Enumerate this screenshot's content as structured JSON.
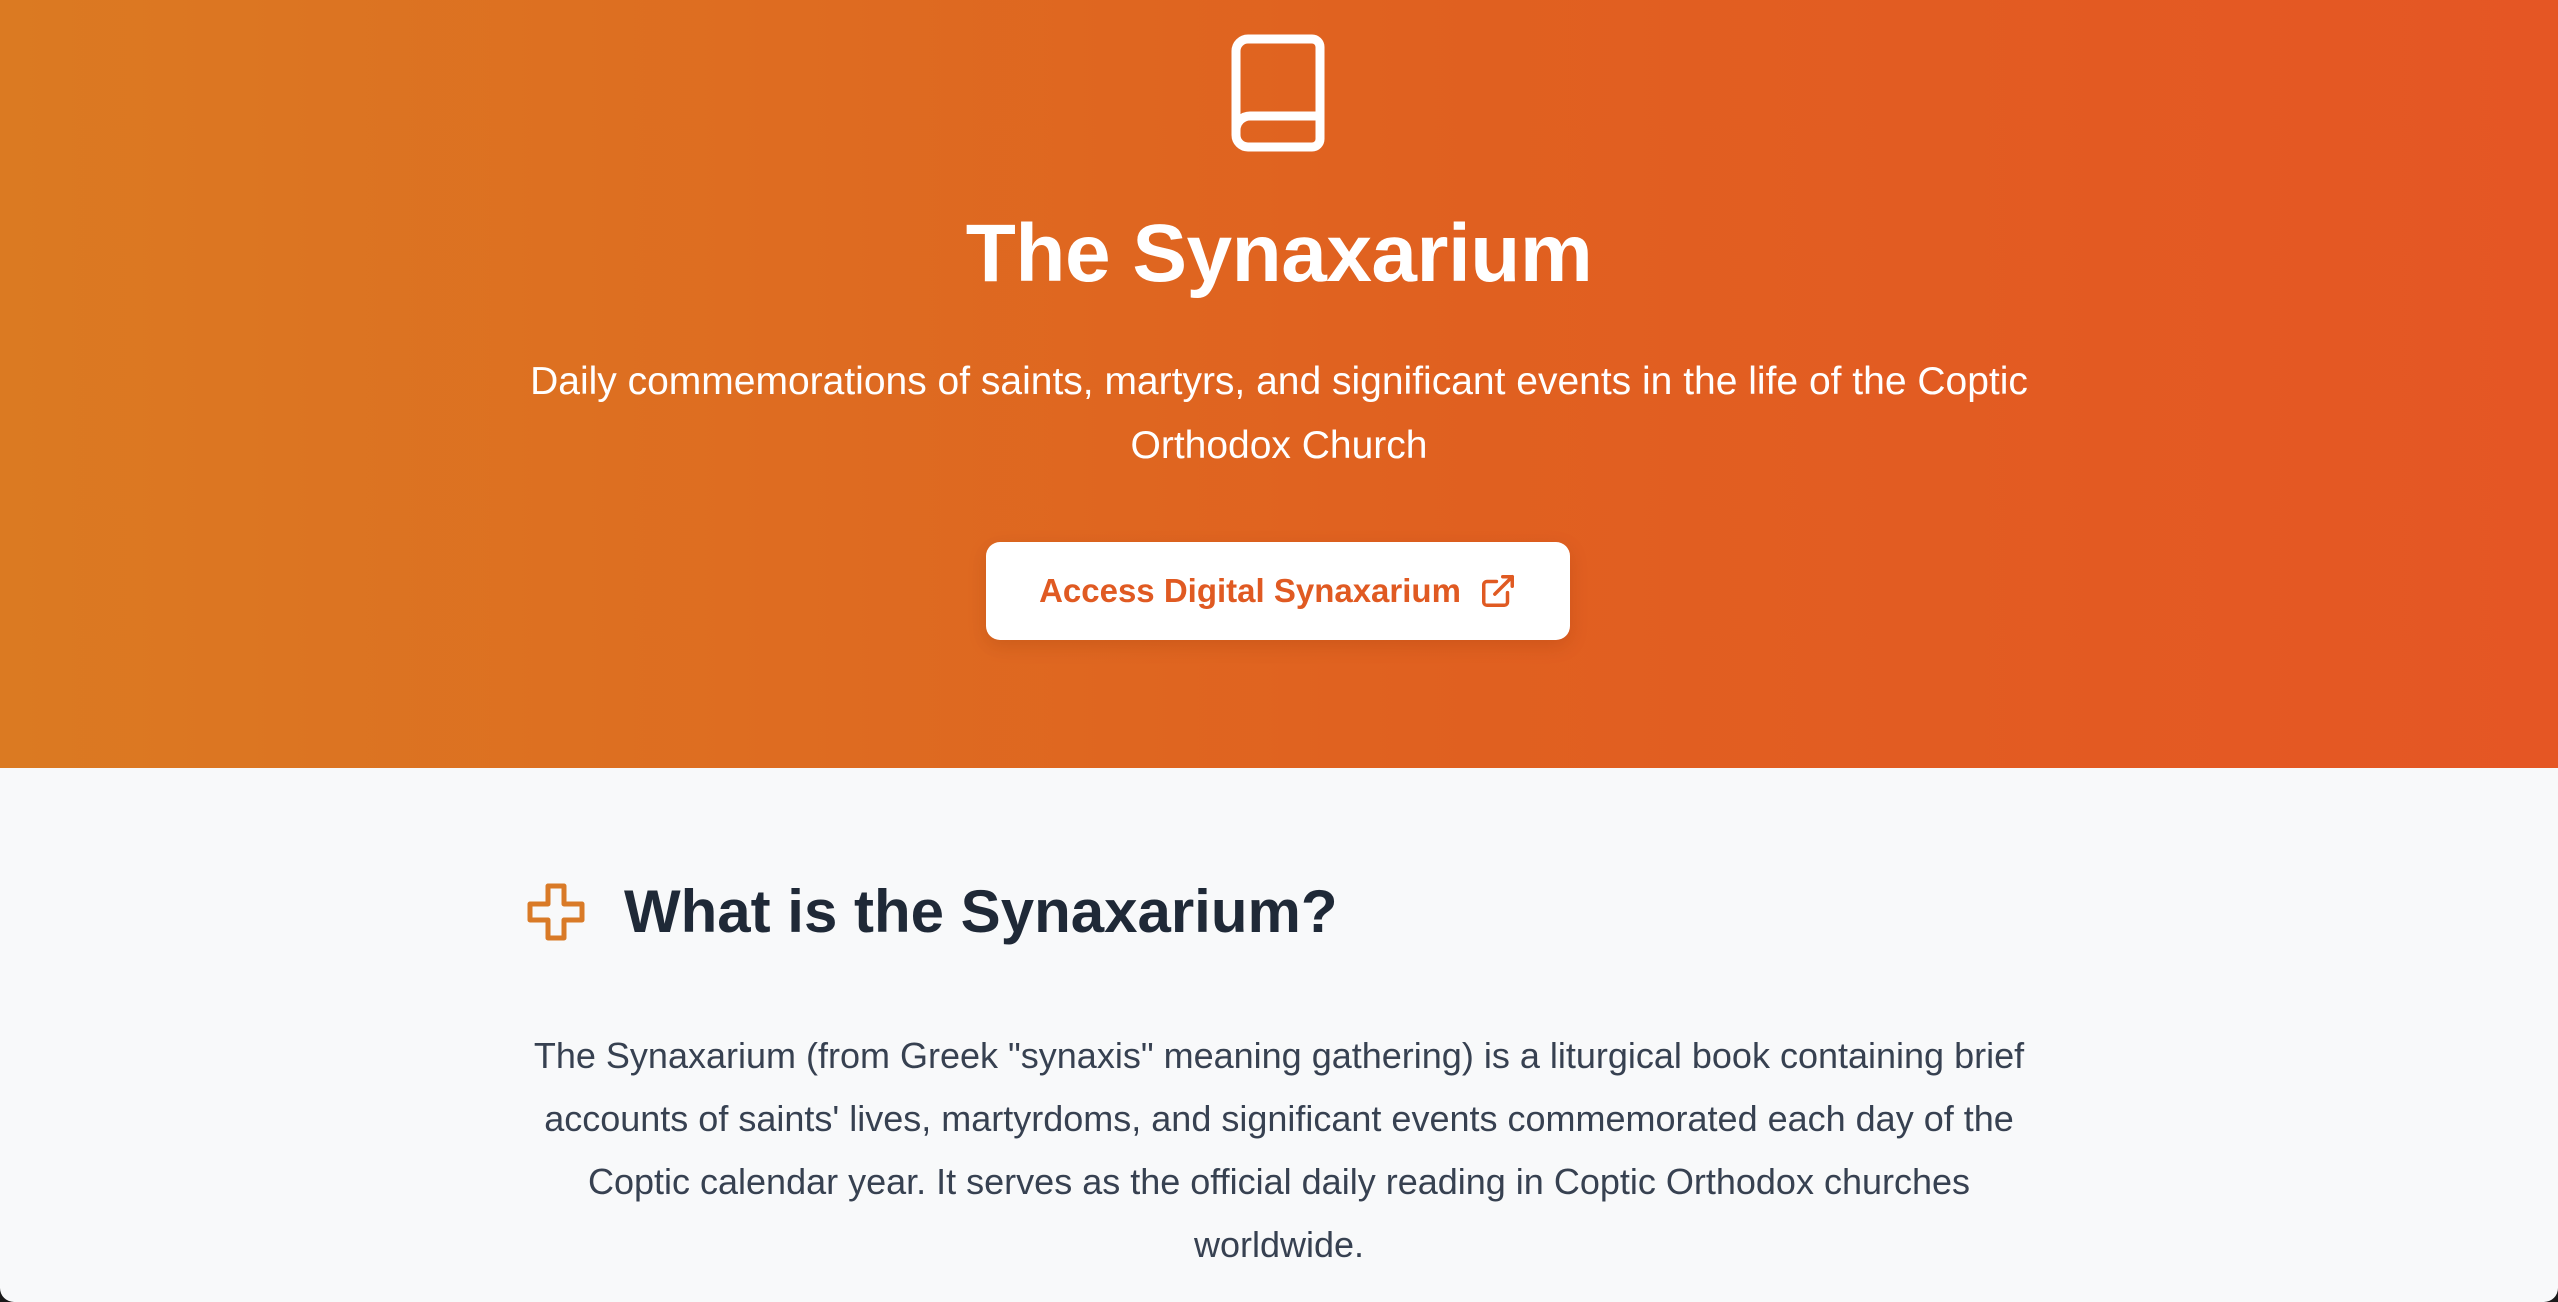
{
  "hero": {
    "icon": "book-icon",
    "title": "The Synaxarium",
    "subtitle": "Daily commemorations of saints, martyrs, and significant events in the life of the Coptic Orthodox Church",
    "cta_label": "Access Digital Synaxarium",
    "cta_icon": "external-link-icon",
    "gradient_start": "#db7a22",
    "gradient_end": "#e55624"
  },
  "about": {
    "icon": "cross-icon",
    "icon_color": "#d97a27",
    "title": "What is the Synaxarium?",
    "body": "The Synaxarium (from Greek \"synaxis\" meaning gathering) is a liturgical book containing brief accounts of saints' lives, martyrdoms, and significant events commemorated each day of the Coptic calendar year. It serves as the official daily reading in Coptic Orthodox churches worldwide."
  }
}
